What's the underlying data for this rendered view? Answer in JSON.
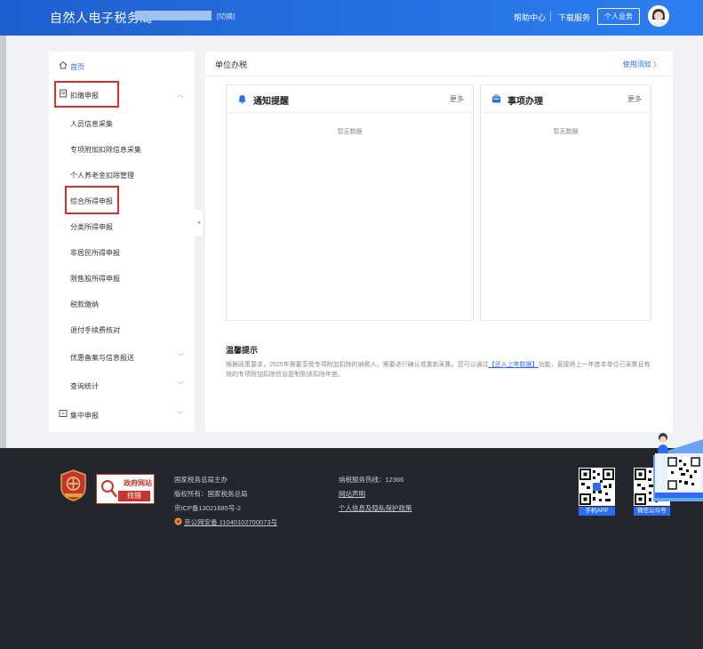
{
  "header": {
    "title": "自然人电子税务局",
    "switch_label": "[切换]",
    "help_label": "帮助中心",
    "download_label": "下载服务",
    "personal_label": "个人业务"
  },
  "sidebar": {
    "home": "首页",
    "declare_group": "扣缴申报",
    "items": [
      "人员信息采集",
      "专项附加扣除信息采集",
      "个人养老金扣除管理",
      "综合所得申报",
      "分类所得申报",
      "非居民所得申报",
      "限售股所得申报",
      "税款缴纳",
      "退付手续费核对",
      "优惠备案与信息报送",
      "查询统计"
    ],
    "central_group": "集中申报"
  },
  "main": {
    "title": "单位办税",
    "usage_label": "使用须知 〉",
    "notice_panel": {
      "title": "通知提醒",
      "more": "更多",
      "empty": "暂无数据"
    },
    "matters_panel": {
      "title": "事项办理",
      "more": "更多",
      "empty": "暂无数据"
    },
    "tips_title": "温馨提示",
    "tips_text_1": "根据政策要求，2025年需要享受专项附加扣除的纳税人，需要进行确认或重新采集。您可以通过",
    "tips_link": "【还入上年数据】",
    "tips_text_2": "功能，直接将上一年度本单位已采集且有效的专项附加扣除信息复制到该扣除年度。"
  },
  "footer": {
    "gov_site_1": "政府网站",
    "gov_site_2": "找错",
    "col1": [
      "国家税务总局主办",
      "版权所有：国家税务总局",
      "京ICP备13021685号-2",
      "京公网安备 11040102700073号"
    ],
    "hotline": "纳税服务热线：12366",
    "site_statement": "网站声明",
    "privacy": "个人信息及隐私保护政策",
    "qr1_label": "手机APP",
    "qr2_label": "微信公众号"
  },
  "colors": {
    "header_blue": "#2d7ff0",
    "accent": "#2d6ef0",
    "highlight_red": "#e02b2b",
    "footer_bg": "#23262d"
  }
}
